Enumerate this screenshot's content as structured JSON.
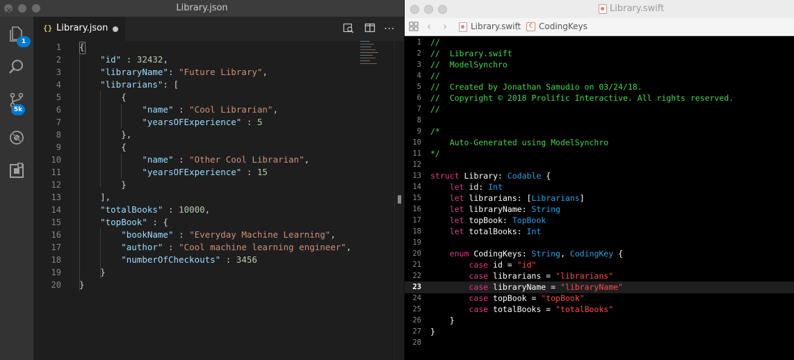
{
  "vscode": {
    "window_title": "Library.json",
    "tab": {
      "label": "Library.json",
      "braces": "{}"
    },
    "activity": {
      "explorer_badge": "1",
      "scm_badge": "5k"
    },
    "colors": {
      "key": "#9cdcfe",
      "string": "#ce9178",
      "number": "#b5cea8",
      "badge": "#007acc"
    },
    "lines": [
      [
        [
          "{",
          "p"
        ]
      ],
      [
        [
          "    ",
          "p"
        ],
        [
          "\"id\"",
          "k"
        ],
        [
          " : ",
          "p"
        ],
        [
          "32432",
          "n"
        ],
        [
          ",",
          "p"
        ]
      ],
      [
        [
          "    ",
          "p"
        ],
        [
          "\"libraryName\"",
          "k"
        ],
        [
          ": ",
          "p"
        ],
        [
          "\"Future Library\"",
          "s"
        ],
        [
          ",",
          "p"
        ]
      ],
      [
        [
          "    ",
          "p"
        ],
        [
          "\"librarians\"",
          "k"
        ],
        [
          ": [",
          "p"
        ]
      ],
      [
        [
          "        {",
          "p"
        ]
      ],
      [
        [
          "            ",
          "p"
        ],
        [
          "\"name\"",
          "k"
        ],
        [
          " : ",
          "p"
        ],
        [
          "\"Cool Librarian\"",
          "s"
        ],
        [
          ",",
          "p"
        ]
      ],
      [
        [
          "            ",
          "p"
        ],
        [
          "\"yearsOFExperience\"",
          "k"
        ],
        [
          " : ",
          "p"
        ],
        [
          "5",
          "n"
        ]
      ],
      [
        [
          "        },",
          "p"
        ]
      ],
      [
        [
          "        {",
          "p"
        ]
      ],
      [
        [
          "            ",
          "p"
        ],
        [
          "\"name\"",
          "k"
        ],
        [
          " : ",
          "p"
        ],
        [
          "\"Other Cool Librarian\"",
          "s"
        ],
        [
          ",",
          "p"
        ]
      ],
      [
        [
          "            ",
          "p"
        ],
        [
          "\"yearsOFExperience\"",
          "k"
        ],
        [
          " : ",
          "p"
        ],
        [
          "15",
          "n"
        ]
      ],
      [
        [
          "        }",
          "p"
        ]
      ],
      [
        [
          "    ],",
          "p"
        ]
      ],
      [
        [
          "    ",
          "p"
        ],
        [
          "\"totalBooks\"",
          "k"
        ],
        [
          " : ",
          "p"
        ],
        [
          "10000",
          "n"
        ],
        [
          ",",
          "p"
        ]
      ],
      [
        [
          "    ",
          "p"
        ],
        [
          "\"topBook\"",
          "k"
        ],
        [
          " : {",
          "p"
        ]
      ],
      [
        [
          "        ",
          "p"
        ],
        [
          "\"bookName\"",
          "k"
        ],
        [
          " : ",
          "p"
        ],
        [
          "\"Everyday Machine Learning\"",
          "s"
        ],
        [
          ",",
          "p"
        ]
      ],
      [
        [
          "        ",
          "p"
        ],
        [
          "\"author\"",
          "k"
        ],
        [
          " : ",
          "p"
        ],
        [
          "\"Cool machine learning engineer\"",
          "s"
        ],
        [
          ",",
          "p"
        ]
      ],
      [
        [
          "        ",
          "p"
        ],
        [
          "\"numberOfCheckouts\"",
          "k"
        ],
        [
          " : ",
          "p"
        ],
        [
          "3456",
          "n"
        ]
      ],
      [
        [
          "    }",
          "p"
        ]
      ],
      [
        [
          "}",
          "p"
        ]
      ]
    ]
  },
  "xcode": {
    "window_title": "Library.swift",
    "breadcrumb": {
      "file": "Library.swift",
      "symbol": "CodingKeys",
      "symbol_icon": "C"
    },
    "current_line": 23,
    "colors": {
      "comment": "#3fd94f",
      "keyword": "#e0368c",
      "type": "#22a3e6",
      "string": "#ff4a4a"
    },
    "lines": [
      [
        [
          "//",
          "cm"
        ]
      ],
      [
        [
          "//  Library.swift",
          "cm"
        ]
      ],
      [
        [
          "//  ModelSynchro",
          "cm"
        ]
      ],
      [
        [
          "//",
          "cm"
        ]
      ],
      [
        [
          "//  Created by Jonathan Samudio on 03/24/18.",
          "cm"
        ]
      ],
      [
        [
          "//  Copyright © 2018 Prolific Interactive. All rights reserved.",
          "cm"
        ]
      ],
      [
        [
          "//",
          "cm"
        ]
      ],
      [
        [
          "",
          "w"
        ]
      ],
      [
        [
          "/*",
          "cm"
        ]
      ],
      [
        [
          "    Auto-Generated using ModelSynchro",
          "cm"
        ]
      ],
      [
        [
          "*/",
          "cm"
        ]
      ],
      [
        [
          "",
          "w"
        ]
      ],
      [
        [
          "struct",
          "kw"
        ],
        [
          " Library: ",
          "w"
        ],
        [
          "Codable",
          "ty"
        ],
        [
          " {",
          "w"
        ]
      ],
      [
        [
          "    ",
          "w"
        ],
        [
          "let",
          "kw"
        ],
        [
          " id: ",
          "w"
        ],
        [
          "Int",
          "ty"
        ]
      ],
      [
        [
          "    ",
          "w"
        ],
        [
          "let",
          "kw"
        ],
        [
          " librarians: [",
          "w"
        ],
        [
          "Librarians",
          "ty"
        ],
        [
          "]",
          "w"
        ]
      ],
      [
        [
          "    ",
          "w"
        ],
        [
          "let",
          "kw"
        ],
        [
          " libraryName: ",
          "w"
        ],
        [
          "String",
          "ty"
        ]
      ],
      [
        [
          "    ",
          "w"
        ],
        [
          "let",
          "kw"
        ],
        [
          " topBook: ",
          "w"
        ],
        [
          "TopBook",
          "ty"
        ]
      ],
      [
        [
          "    ",
          "w"
        ],
        [
          "let",
          "kw"
        ],
        [
          " totalBooks: ",
          "w"
        ],
        [
          "Int",
          "ty"
        ]
      ],
      [
        [
          "",
          "w"
        ]
      ],
      [
        [
          "    ",
          "w"
        ],
        [
          "enum",
          "kw"
        ],
        [
          " CodingKeys: ",
          "w"
        ],
        [
          "String",
          "ty"
        ],
        [
          ", ",
          "w"
        ],
        [
          "CodingKey",
          "ty"
        ],
        [
          " {",
          "w"
        ]
      ],
      [
        [
          "        ",
          "w"
        ],
        [
          "case",
          "kw"
        ],
        [
          " id = ",
          "w"
        ],
        [
          "\"id\"",
          "st"
        ]
      ],
      [
        [
          "        ",
          "w"
        ],
        [
          "case",
          "kw"
        ],
        [
          " librarians = ",
          "w"
        ],
        [
          "\"librarians\"",
          "st"
        ]
      ],
      [
        [
          "        ",
          "w"
        ],
        [
          "case",
          "kw"
        ],
        [
          " libraryName = ",
          "w"
        ],
        [
          "\"libraryName\"",
          "st"
        ]
      ],
      [
        [
          "        ",
          "w"
        ],
        [
          "case",
          "kw"
        ],
        [
          " topBook = ",
          "w"
        ],
        [
          "\"topBook\"",
          "st"
        ]
      ],
      [
        [
          "        ",
          "w"
        ],
        [
          "case",
          "kw"
        ],
        [
          " totalBooks = ",
          "w"
        ],
        [
          "\"totalBooks\"",
          "st"
        ]
      ],
      [
        [
          "    }",
          "w"
        ]
      ],
      [
        [
          "}",
          "w"
        ]
      ],
      [
        [
          "",
          "w"
        ]
      ]
    ]
  }
}
